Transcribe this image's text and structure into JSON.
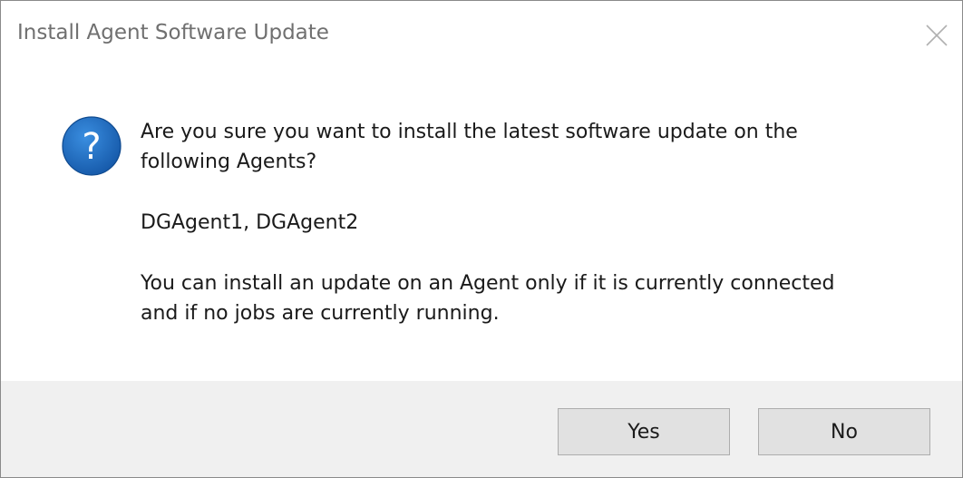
{
  "window": {
    "title": "Install Agent Software Update"
  },
  "icons": {
    "question": "question-icon",
    "close": "close-icon"
  },
  "message": {
    "line1": "Are you sure you want to install the latest software update on the",
    "line2": "following Agents?",
    "agents": "DGAgent1, DGAgent2",
    "note_line1": "You can install an update on an Agent only if it is currently connected",
    "note_line2": "and if no jobs are currently running."
  },
  "buttons": {
    "yes": "Yes",
    "no": "No"
  },
  "colors": {
    "icon_blue": "#1f6fc5",
    "footer_bg": "#f0f0f0",
    "button_bg": "#e1e1e1"
  }
}
